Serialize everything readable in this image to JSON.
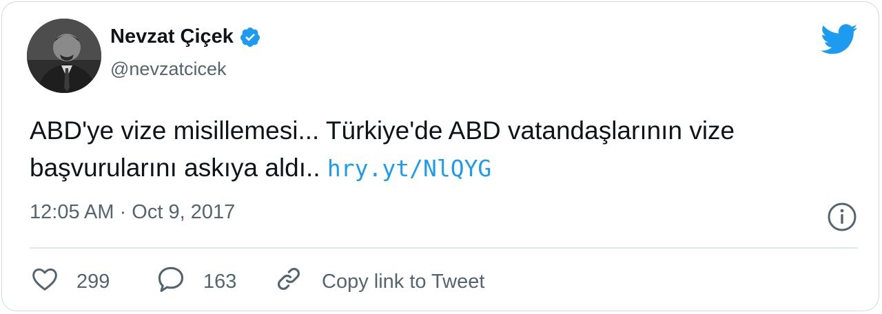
{
  "author": {
    "display_name": "Nevzat Çiçek",
    "handle": "@nevzatcicek",
    "verified": true,
    "avatar_icon": "profile-photo"
  },
  "tweet": {
    "text": "ABD'ye vize misillemesi... Türkiye'de ABD vatandaşlarının vize başvurularını askıya aldı.. ",
    "link": "hry.yt/NlQYG",
    "timestamp": "12:05 AM · Oct 9, 2017"
  },
  "actions": {
    "likes": "299",
    "replies": "163",
    "copy_link_label": "Copy link to Tweet"
  },
  "colors": {
    "brand_blue": "#1d9bf0",
    "text_primary": "#0f1419",
    "text_secondary": "#536471",
    "border": "#cfd9de"
  },
  "icons": [
    "twitter-bird-icon",
    "verified-badge-icon",
    "info-icon",
    "heart-icon",
    "reply-bubble-icon",
    "link-icon"
  ]
}
